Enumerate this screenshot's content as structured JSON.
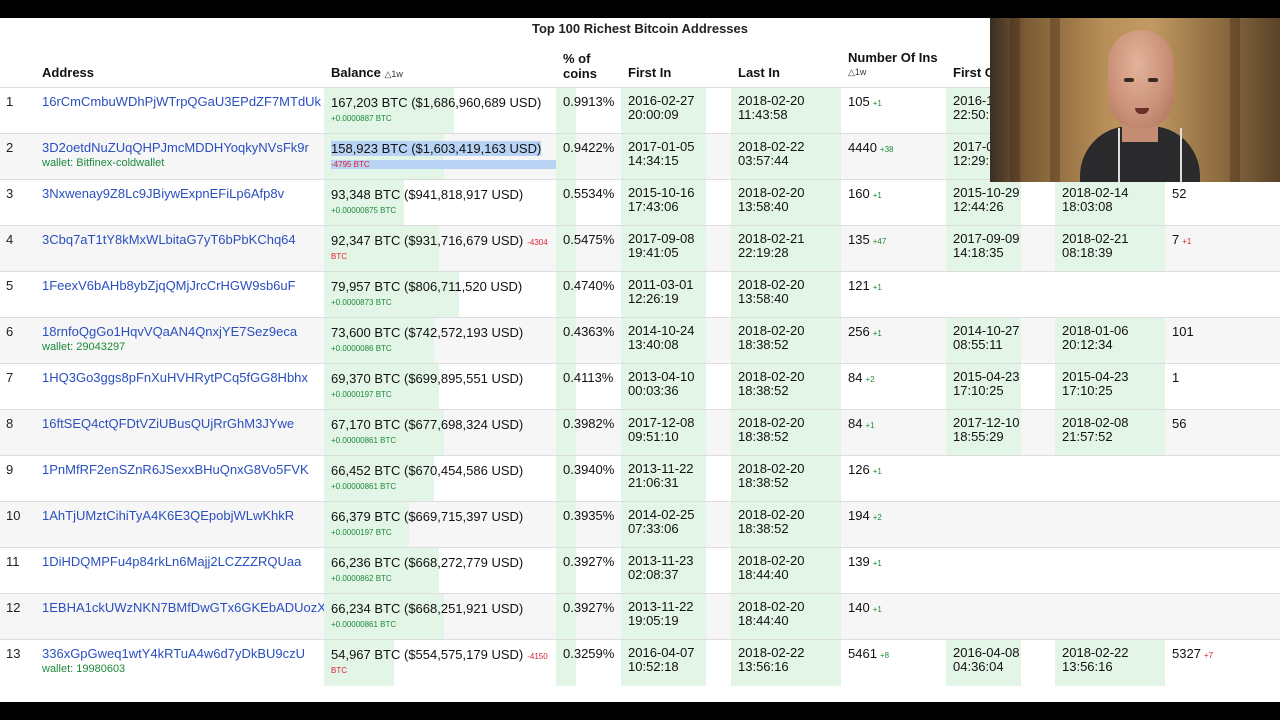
{
  "page": {
    "title": "Top 100 Richest Bitcoin Addresses"
  },
  "headers": {
    "address": "Address",
    "balance": "Balance",
    "balance_delta": "△1w",
    "pct_line1": "% of",
    "pct_line2": "coins",
    "first_in": "First In",
    "last_in": "Last In",
    "num_ins": "Number Of Ins",
    "num_ins_delta": "△1w",
    "first_out": "First O"
  },
  "rows": [
    {
      "rank": "1",
      "address": "16rCmCmbuWDhPjWTrpQGaU3EPdZF7MTdUk",
      "wallet": "",
      "balance": "167,203 BTC ($1,686,960,689 USD)",
      "balance_change": "+0.0000887 BTC",
      "inline_change": "",
      "change_type": "pos",
      "pct": "0.9913%",
      "first_in_date": "2016-02-27",
      "first_in_time": "20:00:09",
      "last_in_date": "2018-02-20",
      "last_in_time": "11:43:58",
      "ins": "105",
      "ins_delta": "+1",
      "first_out_date": "2016-1",
      "first_out_time": "22:50:",
      "last_out_date": "",
      "last_out_time": "",
      "outs": "",
      "outs_delta": ""
    },
    {
      "rank": "2",
      "address": "3D2oetdNuZUqQHPJmcMDDHYoqkyNVsFk9r",
      "wallet": "wallet: Bitfinex-coldwallet",
      "balance": "158,923 BTC ($1,603,419,163 USD)",
      "balance_change": "-4795 BTC",
      "inline_change": "",
      "change_type": "neg",
      "pct": "0.9422%",
      "first_in_date": "2017-01-05",
      "first_in_time": "14:34:15",
      "last_in_date": "2018-02-22",
      "last_in_time": "03:57:44",
      "ins": "4440",
      "ins_delta": "+38",
      "first_out_date": "2017-0",
      "first_out_time": "12:29:",
      "last_out_date": "",
      "last_out_time": "",
      "outs": "",
      "outs_delta": ""
    },
    {
      "rank": "3",
      "address": "3Nxwenay9Z8Lc9JBiywExpnEFiLp6Afp8v",
      "wallet": "",
      "balance": "93,348 BTC ($941,818,917 USD)",
      "balance_change": "+0.00000875 BTC",
      "inline_change": "",
      "change_type": "pos",
      "pct": "0.5534%",
      "first_in_date": "2015-10-16",
      "first_in_time": "17:43:06",
      "last_in_date": "2018-02-20",
      "last_in_time": "13:58:40",
      "ins": "160",
      "ins_delta": "+1",
      "first_out_date": "2015-10-29",
      "first_out_time": "12:44:26",
      "last_out_date": "2018-02-14",
      "last_out_time": "18:03:08",
      "outs": "52",
      "outs_delta": ""
    },
    {
      "rank": "4",
      "address": "3Cbq7aT1tY8kMxWLbitaG7yT6bPbKChq64",
      "wallet": "",
      "balance": "92,347 BTC ($931,716,679 USD)",
      "balance_change": "BTC",
      "inline_change": "-4304",
      "change_type": "neg",
      "pct": "0.5475%",
      "first_in_date": "2017-09-08",
      "first_in_time": "19:41:05",
      "last_in_date": "2018-02-21",
      "last_in_time": "22:19:28",
      "ins": "135",
      "ins_delta": "+47",
      "first_out_date": "2017-09-09",
      "first_out_time": "14:18:35",
      "last_out_date": "2018-02-21",
      "last_out_time": "08:18:39",
      "outs": "7",
      "outs_delta": "+1"
    },
    {
      "rank": "5",
      "address": "1FeexV6bAHb8ybZjqQMjJrcCrHGW9sb6uF",
      "wallet": "",
      "balance": "79,957 BTC ($806,711,520 USD)",
      "balance_change": "+0.0000873 BTC",
      "inline_change": "",
      "change_type": "pos",
      "pct": "0.4740%",
      "first_in_date": "2011-03-01",
      "first_in_time": "12:26:19",
      "last_in_date": "2018-02-20",
      "last_in_time": "13:58:40",
      "ins": "121",
      "ins_delta": "+1",
      "first_out_date": "",
      "first_out_time": "",
      "last_out_date": "",
      "last_out_time": "",
      "outs": "",
      "outs_delta": ""
    },
    {
      "rank": "6",
      "address": "18rnfoQgGo1HqvVQaAN4QnxjYE7Sez9eca",
      "wallet": "wallet: 29043297",
      "balance": "73,600 BTC ($742,572,193 USD)",
      "balance_change": "+0.0000086 BTC",
      "inline_change": "",
      "change_type": "pos",
      "pct": "0.4363%",
      "first_in_date": "2014-10-24",
      "first_in_time": "13:40:08",
      "last_in_date": "2018-02-20",
      "last_in_time": "18:38:52",
      "ins": "256",
      "ins_delta": "+1",
      "first_out_date": "2014-10-27",
      "first_out_time": "08:55:11",
      "last_out_date": "2018-01-06",
      "last_out_time": "20:12:34",
      "outs": "101",
      "outs_delta": ""
    },
    {
      "rank": "7",
      "address": "1HQ3Go3ggs8pFnXuHVHRytPCq5fGG8Hbhx",
      "wallet": "",
      "balance": "69,370 BTC ($699,895,551 USD)",
      "balance_change": "+0.0000197 BTC",
      "inline_change": "",
      "change_type": "pos",
      "pct": "0.4113%",
      "first_in_date": "2013-04-10",
      "first_in_time": "00:03:36",
      "last_in_date": "2018-02-20",
      "last_in_time": "18:38:52",
      "ins": "84",
      "ins_delta": "+2",
      "first_out_date": "2015-04-23",
      "first_out_time": "17:10:25",
      "last_out_date": "2015-04-23",
      "last_out_time": "17:10:25",
      "outs": "1",
      "outs_delta": ""
    },
    {
      "rank": "8",
      "address": "16ftSEQ4ctQFDtVZiUBusQUjRrGhM3JYwe",
      "wallet": "",
      "balance": "67,170 BTC ($677,698,324 USD)",
      "balance_change": "+0.00000861 BTC",
      "inline_change": "",
      "change_type": "pos",
      "pct": "0.3982%",
      "first_in_date": "2017-12-08",
      "first_in_time": "09:51:10",
      "last_in_date": "2018-02-20",
      "last_in_time": "18:38:52",
      "ins": "84",
      "ins_delta": "+1",
      "first_out_date": "2017-12-10",
      "first_out_time": "18:55:29",
      "last_out_date": "2018-02-08",
      "last_out_time": "21:57:52",
      "outs": "56",
      "outs_delta": ""
    },
    {
      "rank": "9",
      "address": "1PnMfRF2enSZnR6JSexxBHuQnxG8Vo5FVK",
      "wallet": "",
      "balance": "66,452 BTC ($670,454,586 USD)",
      "balance_change": "+0.00000861 BTC",
      "inline_change": "",
      "change_type": "pos",
      "pct": "0.3940%",
      "first_in_date": "2013-11-22",
      "first_in_time": "21:06:31",
      "last_in_date": "2018-02-20",
      "last_in_time": "18:38:52",
      "ins": "126",
      "ins_delta": "+1",
      "first_out_date": "",
      "first_out_time": "",
      "last_out_date": "",
      "last_out_time": "",
      "outs": "",
      "outs_delta": ""
    },
    {
      "rank": "10",
      "address": "1AhTjUMztCihiTyA4K6E3QEpobjWLwKhkR",
      "wallet": "",
      "balance": "66,379 BTC ($669,715,397 USD)",
      "balance_change": "+0.0000197 BTC",
      "inline_change": "",
      "change_type": "pos",
      "pct": "0.3935%",
      "first_in_date": "2014-02-25",
      "first_in_time": "07:33:06",
      "last_in_date": "2018-02-20",
      "last_in_time": "18:38:52",
      "ins": "194",
      "ins_delta": "+2",
      "first_out_date": "",
      "first_out_time": "",
      "last_out_date": "",
      "last_out_time": "",
      "outs": "",
      "outs_delta": ""
    },
    {
      "rank": "11",
      "address": "1DiHDQMPFu4p84rkLn6Majj2LCZZZRQUaa",
      "wallet": "",
      "balance": "66,236 BTC ($668,272,779 USD)",
      "balance_change": "+0.0000862 BTC",
      "inline_change": "",
      "change_type": "pos",
      "pct": "0.3927%",
      "first_in_date": "2013-11-23",
      "first_in_time": "02:08:37",
      "last_in_date": "2018-02-20",
      "last_in_time": "18:44:40",
      "ins": "139",
      "ins_delta": "+1",
      "first_out_date": "",
      "first_out_time": "",
      "last_out_date": "",
      "last_out_time": "",
      "outs": "",
      "outs_delta": ""
    },
    {
      "rank": "12",
      "address": "1EBHA1ckUWzNKN7BMfDwGTx6GKEbADUozX",
      "wallet": "",
      "balance": "66,234 BTC ($668,251,921 USD)",
      "balance_change": "+0.00000861 BTC",
      "inline_change": "",
      "change_type": "pos",
      "pct": "0.3927%",
      "first_in_date": "2013-11-22",
      "first_in_time": "19:05:19",
      "last_in_date": "2018-02-20",
      "last_in_time": "18:44:40",
      "ins": "140",
      "ins_delta": "+1",
      "first_out_date": "",
      "first_out_time": "",
      "last_out_date": "",
      "last_out_time": "",
      "outs": "",
      "outs_delta": ""
    },
    {
      "rank": "13",
      "address": "336xGpGweq1wtY4kRTuA4w6d7yDkBU9czU",
      "wallet": "wallet: 19980603",
      "balance": "54,967 BTC ($554,575,179 USD)",
      "balance_change": "BTC",
      "inline_change": "-4150",
      "change_type": "neg",
      "pct": "0.3259%",
      "first_in_date": "2016-04-07",
      "first_in_time": "10:52:18",
      "last_in_date": "2018-02-22",
      "last_in_time": "13:56:16",
      "ins": "5461",
      "ins_delta": "+8",
      "first_out_date": "2016-04-08",
      "first_out_time": "04:36:04",
      "last_out_date": "2018-02-22",
      "last_out_time": "13:56:16",
      "outs": "5327",
      "outs_delta": "+7"
    }
  ]
}
